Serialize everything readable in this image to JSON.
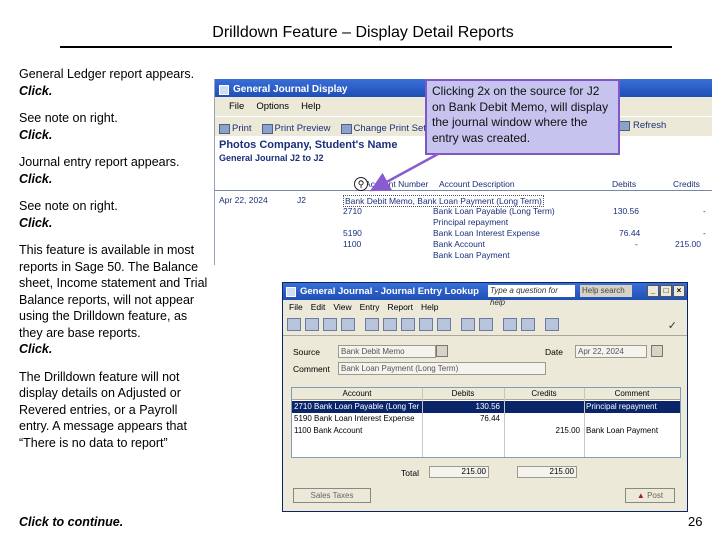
{
  "slide": {
    "title": "Drilldown Feature – Display Detail Reports",
    "page_number": "26",
    "click_to_continue": "Click to continue."
  },
  "notes": {
    "p1_text": "General Ledger report appears.",
    "p1_click": "Click.",
    "p2_text": "See note on right.",
    "p2_click": "Click.",
    "p3_text": "Journal entry report appears.",
    "p3_click": "Click.",
    "p4_text": "See note on right.",
    "p4_click": "Click.",
    "p5_text": "This feature is available in most  reports in Sage 50. The Balance sheet, Income statement and Trial Balance reports, will not appear using the Drilldown feature, as they are base reports.",
    "p5_click": "Click.",
    "p6_text": "The Drilldown feature will not display details on Adjusted or Revered entries, or a Payroll entry. A message appears that “There is no data to report”"
  },
  "callout": {
    "text": "Clicking  2x on the source for J2 on Bank Debit Memo, will display the journal window where the entry was created."
  },
  "gjd": {
    "title": "General Journal Display",
    "menu": [
      "File",
      "Options",
      "Help"
    ],
    "toolbar": [
      "Print",
      "Print Preview",
      "Change Print Settings"
    ],
    "refresh": "Refresh",
    "company": "Photos Company, Student's Name",
    "subtitle": "General Journal J2 to J2",
    "headers": {
      "account_number": "Account Number",
      "account_description": "Account Description",
      "debits": "Debits",
      "credits": "Credits"
    },
    "rows": [
      {
        "date": "Apr 22, 2024",
        "jnum": "J2",
        "acct": "Bank Debit Memo, Bank Loan Payment (Long Term)",
        "desc": "",
        "debit": "",
        "credit": ""
      },
      {
        "date": "",
        "jnum": "",
        "acct": "2710",
        "desc": "Bank Loan Payable (Long Term)",
        "debit": "130.56",
        "credit": "-"
      },
      {
        "date": "",
        "jnum": "",
        "acct": "",
        "desc": "Principal repayment",
        "debit": "",
        "credit": ""
      },
      {
        "date": "",
        "jnum": "",
        "acct": "5190",
        "desc": "Bank Loan Interest Expense",
        "debit": "76.44",
        "credit": "-"
      },
      {
        "date": "",
        "jnum": "",
        "acct": "1100",
        "desc": "Bank Account",
        "debit": "-",
        "credit": "215.00"
      },
      {
        "date": "",
        "jnum": "",
        "acct": "",
        "desc": "Bank Loan Payment",
        "debit": "",
        "credit": ""
      }
    ]
  },
  "gjl": {
    "title": "General Journal - Journal Entry Lookup",
    "ask_placeholder": "Type a question for help",
    "search_label": "Help search",
    "menu": [
      "File",
      "Edit",
      "View",
      "Entry",
      "Report",
      "Help"
    ],
    "source_label": "Source",
    "source_value": "Bank Debit Memo",
    "date_label": "Date",
    "date_value": "Apr 22, 2024",
    "comment_label": "Comment",
    "comment_value": "Bank Loan Payment (Long Term)",
    "grid_headers": {
      "account": "Account",
      "debits": "Debits",
      "credits": "Credits",
      "comment": "Comment"
    },
    "grid_rows": [
      {
        "account": "2710 Bank Loan Payable (Long Ter",
        "debits": "130.56",
        "credits": "",
        "comment": "Principal repayment",
        "selected": true
      },
      {
        "account": "5190 Bank Loan Interest Expense",
        "debits": "76.44",
        "credits": "",
        "comment": "",
        "selected": false
      },
      {
        "account": "1100 Bank Account",
        "debits": "",
        "credits": "215.00",
        "comment": "Bank Loan Payment",
        "selected": false
      }
    ],
    "total_label": "Total",
    "total_debits": "215.00",
    "total_credits": "215.00",
    "sales_taxes_label": "Sales Taxes",
    "post_label": "Post"
  }
}
